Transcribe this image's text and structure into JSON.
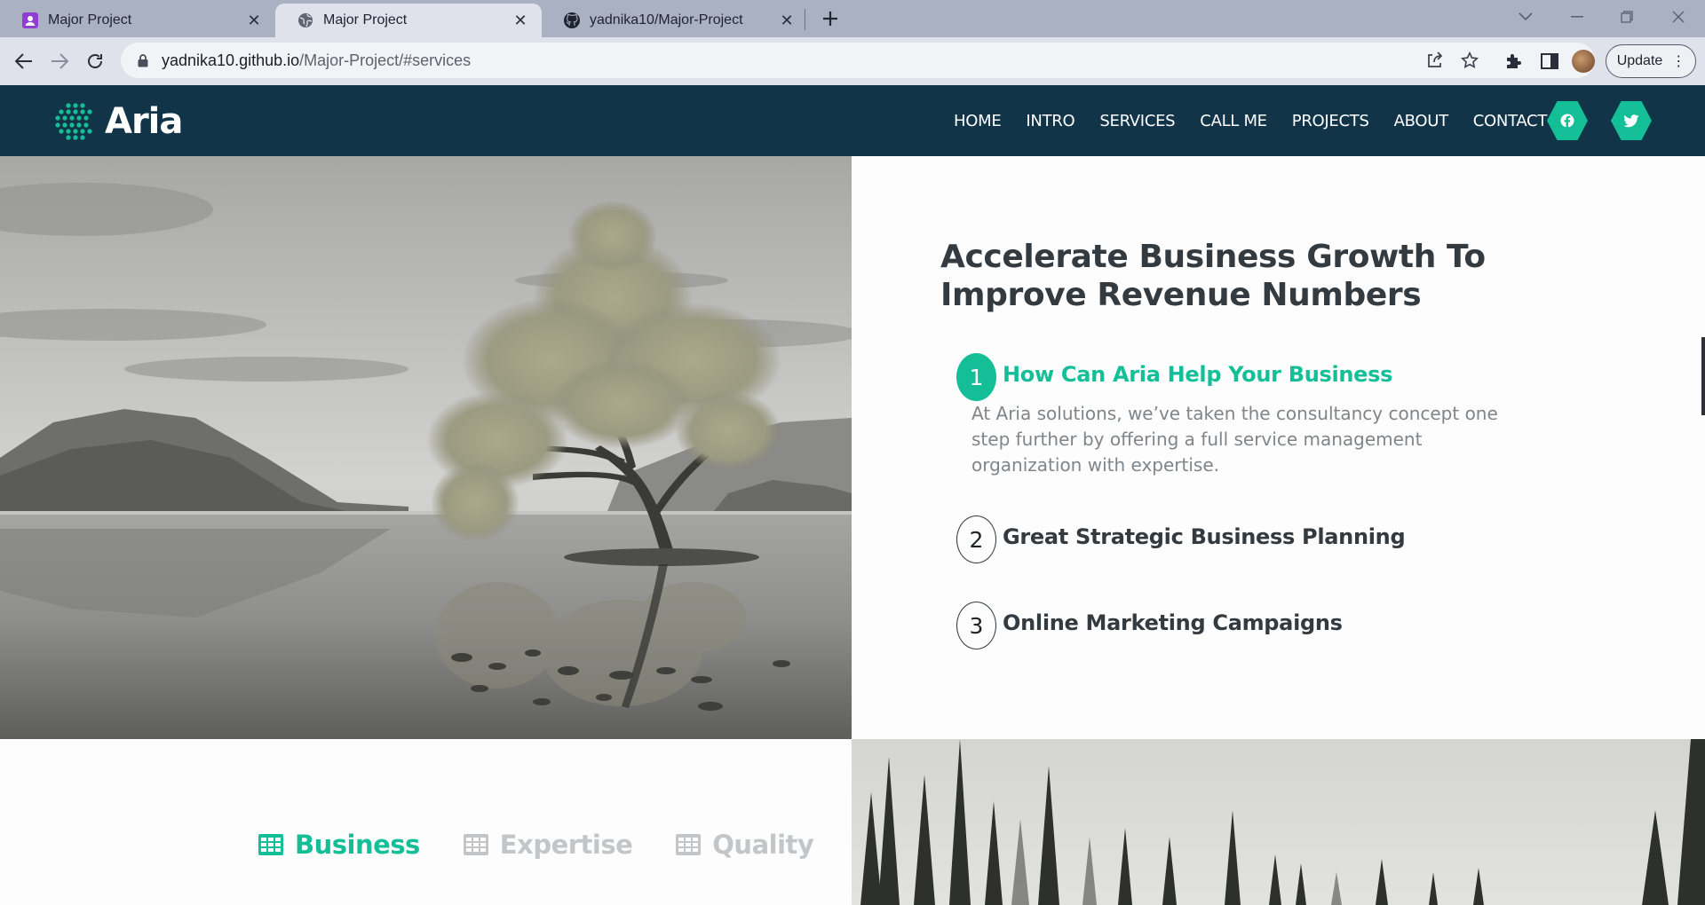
{
  "browser": {
    "tabs": [
      {
        "label": "Major Project",
        "favicon": "profile-icon"
      },
      {
        "label": "Major Project",
        "favicon": "globe-icon"
      },
      {
        "label": "yadnika10/Major-Project",
        "favicon": "github-icon"
      }
    ],
    "url_host": "yadnika10.github.io",
    "url_path": "/Major-Project/#services",
    "update_label": "Update"
  },
  "site": {
    "brand": "Aria",
    "nav": [
      "HOME",
      "INTRO",
      "SERVICES",
      "CALL ME",
      "PROJECTS",
      "ABOUT",
      "CONTACT"
    ],
    "social": [
      "facebook-icon",
      "twitter-icon"
    ],
    "accent_color": "#14bf98",
    "header_color": "#113448"
  },
  "hero": {
    "title": "Accelerate Business Growth To Improve Revenue Numbers",
    "items": [
      {
        "num": "1",
        "title": "How Can Aria Help Your Business",
        "body": "At Aria solutions, we’ve taken the consultancy concept one step further by offering a full service management organization with expertise."
      },
      {
        "num": "2",
        "title": "Great Strategic Business Planning"
      },
      {
        "num": "3",
        "title": "Online Marketing Campaigns"
      }
    ]
  },
  "lower": {
    "tabs": [
      {
        "label": "Business",
        "active": true
      },
      {
        "label": "Expertise",
        "active": false
      },
      {
        "label": "Quality",
        "active": false
      }
    ]
  }
}
